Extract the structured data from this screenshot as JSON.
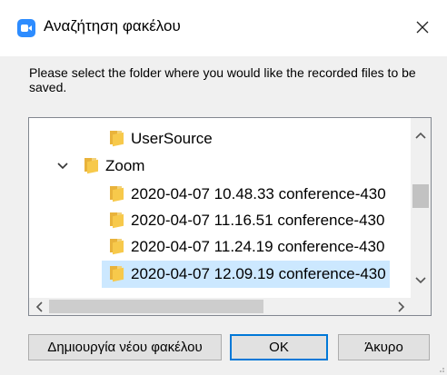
{
  "dialog": {
    "title": "Αναζήτηση φακέλου",
    "prompt": "Please select the folder where you would like the recorded files to be saved.",
    "accent_color": "#0078d7",
    "app_icon": "zoom-app-icon"
  },
  "tree": {
    "items": [
      {
        "label": "UserSource",
        "icon": "folder-icon"
      },
      {
        "label": "Zoom",
        "icon": "folder-icon",
        "expanded": true
      },
      {
        "label": "2020-04-07 10.48.33 conference-430",
        "icon": "folder-icon"
      },
      {
        "label": "2020-04-07 11.16.51 conference-430",
        "icon": "folder-icon"
      },
      {
        "label": "2020-04-07 11.24.19 conference-430",
        "icon": "folder-icon"
      },
      {
        "label": "2020-04-07 12.09.19 conference-430",
        "icon": "folder-icon",
        "selected": true
      }
    ]
  },
  "buttons": {
    "new_folder": "Δημιουργία νέου φακέλου",
    "ok": "OK",
    "cancel": "Άκυρο"
  }
}
